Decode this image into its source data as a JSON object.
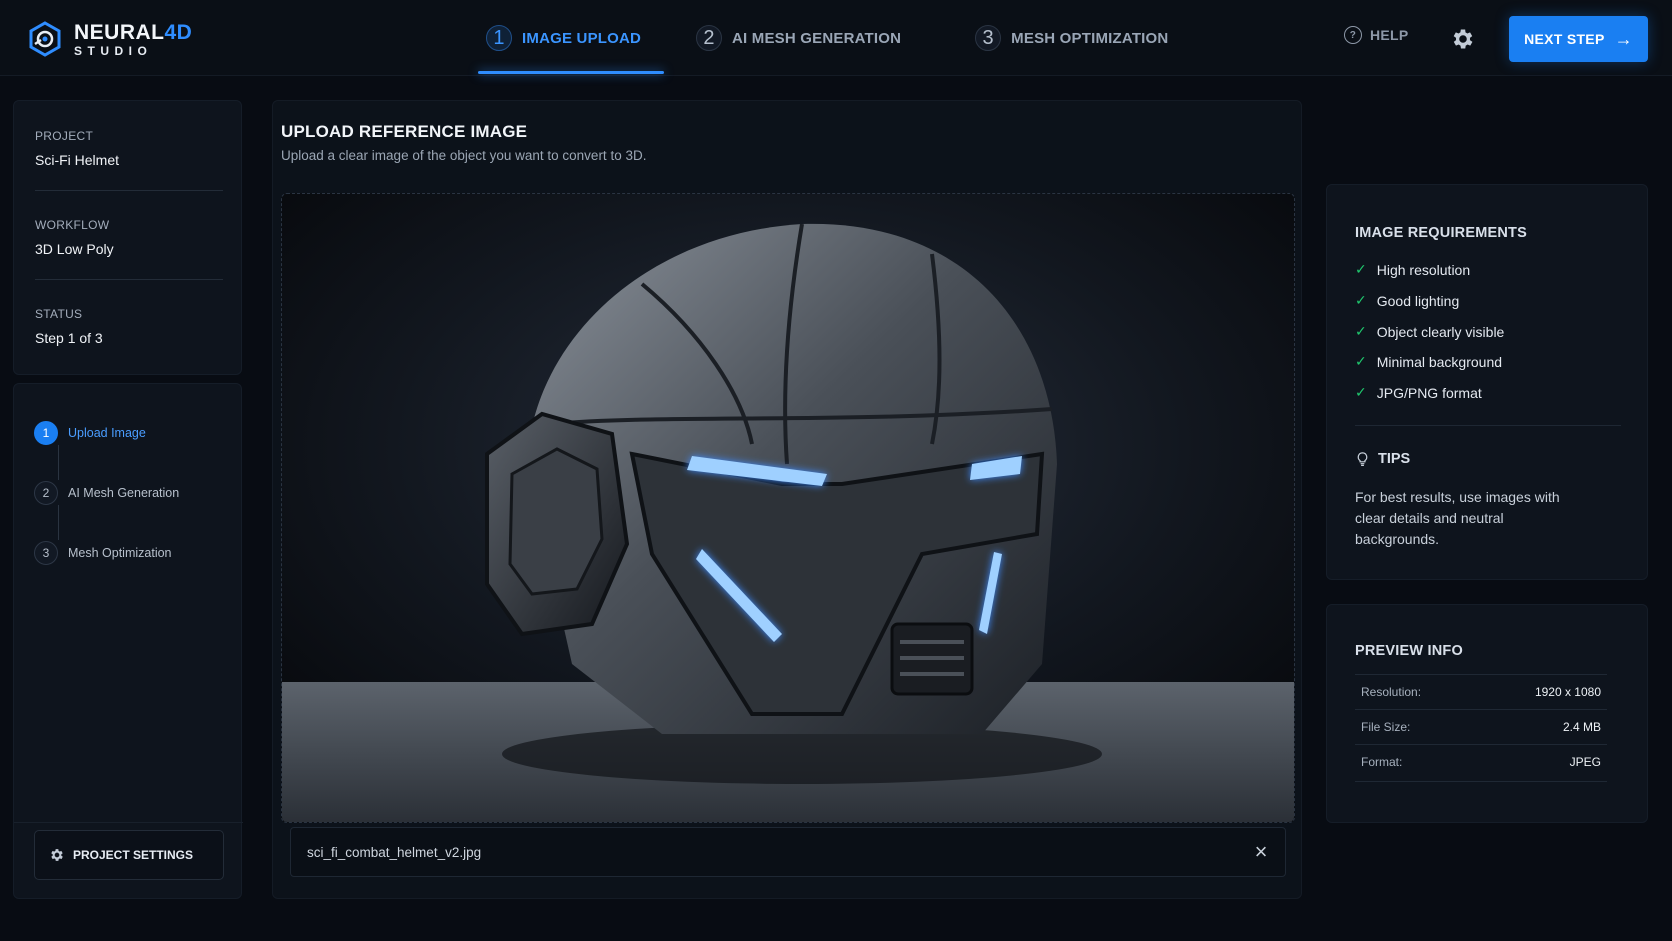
{
  "brand": {
    "name_main": "NEURAL",
    "name_accent": "4D",
    "sub": "STUDIO"
  },
  "nav": {
    "steps": [
      {
        "num": "1",
        "label": "IMAGE UPLOAD"
      },
      {
        "num": "2",
        "label": "AI MESH GENERATION"
      },
      {
        "num": "3",
        "label": "MESH OPTIMIZATION"
      }
    ],
    "help_label": "HELP",
    "next_label": "NEXT STEP"
  },
  "sidebar": {
    "project_label": "PROJECT",
    "project_value": "Sci-Fi Helmet",
    "workflow_label": "WORKFLOW",
    "workflow_value": "3D Low Poly",
    "status_label": "STATUS",
    "status_value": "Step 1 of 3",
    "steps": [
      {
        "num": "1",
        "label": "Upload Image"
      },
      {
        "num": "2",
        "label": "AI Mesh Generation"
      },
      {
        "num": "3",
        "label": "Mesh Optimization"
      }
    ],
    "settings_label": "PROJECT SETTINGS"
  },
  "main": {
    "title": "UPLOAD REFERENCE IMAGE",
    "subtitle": "Upload a clear image of the object you want to convert to 3D.",
    "file_name": "sci_fi_combat_helmet_v2.jpg"
  },
  "requirements": {
    "title": "IMAGE REQUIREMENTS",
    "items": [
      "High resolution",
      "Good lighting",
      "Object clearly visible",
      "Minimal background",
      "JPG/PNG format"
    ],
    "tips_title": "TIPS",
    "tips_text": "For best results, use images with clear details and neutral backgrounds."
  },
  "preview": {
    "title": "PREVIEW INFO",
    "rows": [
      {
        "key": "Resolution:",
        "value": "1920 x 1080"
      },
      {
        "key": "File Size:",
        "value": "2.4 MB"
      },
      {
        "key": "Format:",
        "value": "JPEG"
      }
    ]
  },
  "colors": {
    "accent": "#1a7ff2",
    "check": "#1fc76d",
    "background": "#080c13"
  }
}
